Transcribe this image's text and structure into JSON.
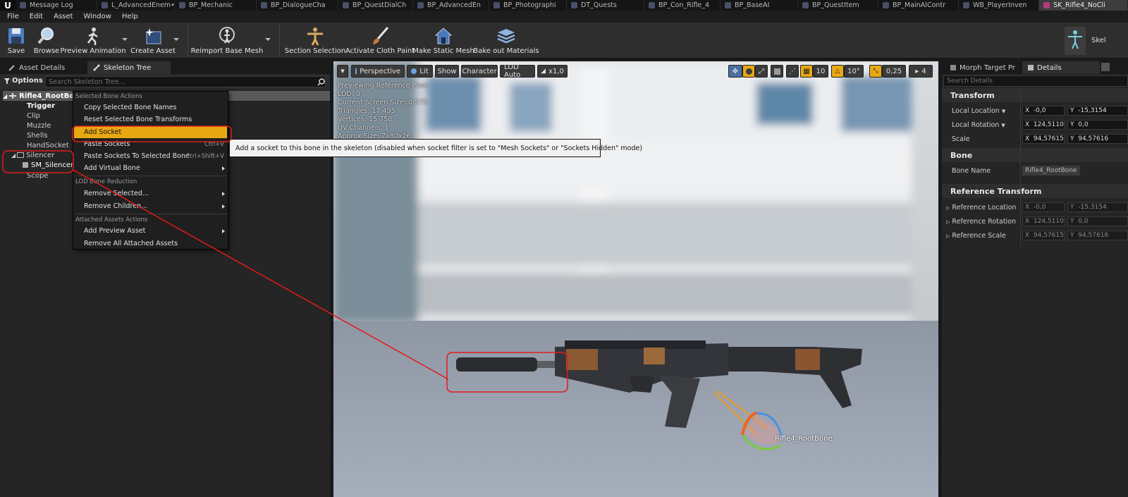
{
  "tabs": [
    {
      "label": "Message Log"
    },
    {
      "label": "L_AdvancedEnem•"
    },
    {
      "label": "BP_Mechanic"
    },
    {
      "label": "BP_DialogueCha"
    },
    {
      "label": "BP_QuestDialCh"
    },
    {
      "label": "BP_AdvancedEn"
    },
    {
      "label": "BP_Photographi"
    },
    {
      "label": "DT_Quests"
    },
    {
      "label": "BP_Con_Rifle_4"
    },
    {
      "label": "BP_BaseAI"
    },
    {
      "label": "BP_QuestItem"
    },
    {
      "label": "BP_MainAIContr"
    },
    {
      "label": "WB_PlayerInven"
    },
    {
      "label": "SK_Rifle4_NoCli"
    }
  ],
  "menu": [
    "File",
    "Edit",
    "Asset",
    "Window",
    "Help"
  ],
  "toolbar": {
    "save": "Save",
    "browse": "Browse",
    "preview_animation": "Preview Animation",
    "create_asset": "Create Asset",
    "reimport": "Reimport Base Mesh",
    "section_selection": "Section Selection",
    "cloth_paint": "Activate Cloth Paint",
    "static_mesh": "Make Static Mesh",
    "bake_materials": "Bake out Materials",
    "skeleton_label": "Skel"
  },
  "left_panel": {
    "tab_asset_details": "Asset Details",
    "tab_skeleton_tree": "Skeleton Tree",
    "options": "Options",
    "search_placeholder": "Search Skeleton Tree...",
    "root_bone": "Rifle4_RootBone",
    "tree": [
      "Trigger",
      "Clip",
      "Muzzle",
      "Shells",
      "HandSocket",
      "Silencer",
      "SM_Silencer",
      "Scope"
    ]
  },
  "context_menu": {
    "heading_selected": "Selected Bone Actions",
    "copy_names": "Copy Selected Bone Names",
    "reset_transforms": "Reset Selected Bone Transforms",
    "add_socket": "Add Socket",
    "paste_sockets": "Paste Sockets",
    "paste_sockets_shortcut": "Ctrl+V",
    "paste_sockets_selected": "Paste Sockets To Selected Bone",
    "paste_sockets_selected_shortcut": "Ctrl+Shift+V",
    "add_virtual_bone": "Add Virtual Bone",
    "heading_lod": "LOD Bone Reduction",
    "remove_selected": "Remove Selected...",
    "remove_children": "Remove Children...",
    "heading_attached": "Attached Assets Actions",
    "add_preview_asset": "Add Preview Asset",
    "remove_all_attached": "Remove All Attached Assets"
  },
  "tooltip": "Add a socket to this bone in the skeleton (disabled when socket filter is set to \"Mesh Sockets\" or \"Sockets Hidden\" mode)",
  "viewport": {
    "perspective": "Perspective",
    "lit": "Lit",
    "show": "Show",
    "character": "Character",
    "lod": "LOD Auto",
    "speed": "x1,0",
    "grid_snap": "10",
    "rot_snap": "10°",
    "scale_snap": "0,25",
    "camera_speed": "4",
    "stats": [
      "Previewing Reference Pose",
      "LOD: 0",
      "Current Screen Size: 0,575",
      "Triangles: 17 495",
      "Vertices: 15 758",
      "UV Channels: 1",
      "Approx Size: 7x80x26"
    ],
    "bone_label": "Rifle4_RootBone"
  },
  "right_panel": {
    "tab_morph": "Morph Target Pr",
    "tab_details": "Details",
    "search_placeholder": "Search Details",
    "transform": "Transform",
    "local_location": "Local Location",
    "local_rotation": "Local Rotation",
    "scale": "Scale",
    "loc_x": "-0,0",
    "loc_y": "-15,3154",
    "rot_x": "124,5110",
    "rot_y": "0,0",
    "scale_x": "94,57615",
    "scale_y": "94,57616",
    "bone": "Bone",
    "bone_name_label": "Bone Name",
    "bone_name": "Rifle4_RootBone",
    "ref_transform": "Reference Transform",
    "ref_location": "Reference Location",
    "ref_rotation": "Reference Rotation",
    "ref_scale": "Reference Scale"
  },
  "colors": {
    "highlight": "#e8a812",
    "annotation": "#e21b1b",
    "panel": "#252525"
  }
}
